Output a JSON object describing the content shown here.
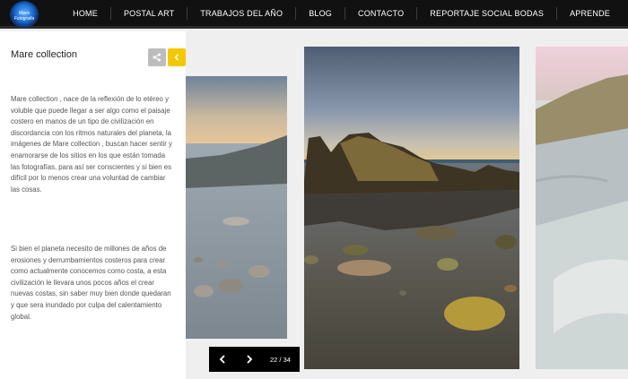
{
  "site": {
    "logo_text": "Maris Fotografia"
  },
  "nav": {
    "items": [
      {
        "label": "HOME"
      },
      {
        "label": "POSTAL ART"
      },
      {
        "label": "TRABAJOS DEL AÑO"
      },
      {
        "label": "BLOG"
      },
      {
        "label": "CONTACTO"
      },
      {
        "label": "REPORTAJE SOCIAL BODAS"
      },
      {
        "label": "APRENDE"
      }
    ]
  },
  "panel": {
    "title": "Mare collection",
    "paragraph1": "Mare collection , nace de la reflexión de lo etéreo y voluble que puede llegar a ser algo como el paisaje costero en manos de un tipo de civilización en discordancia con los ritmos naturales del planeta, la imágenes de Mare collection , buscan hacer sentir y enamorarse de los sitios en los que están tomada las fotografías, para así ser conscientes y si bien es difícil por lo menos crear una voluntad de cambiar las cosas.",
    "paragraph2": "Si bien el planeta necesito de millones de años de erosiones y derrumbamientos costeros para crear como actualmente conocemos como costa, a esta civilización le llevara unos pocos años el crear nuevas costas, sin saber muy bien donde quedaran y que sera inundado por culpa del calentamiento global.",
    "share_icon": "share-icon",
    "collapse_icon": "chevron-left-icon",
    "accent_color": "#f4c800"
  },
  "slider": {
    "counter": "22 / 34",
    "prev_icon": "chevron-left-icon",
    "next_icon": "chevron-right-icon"
  }
}
